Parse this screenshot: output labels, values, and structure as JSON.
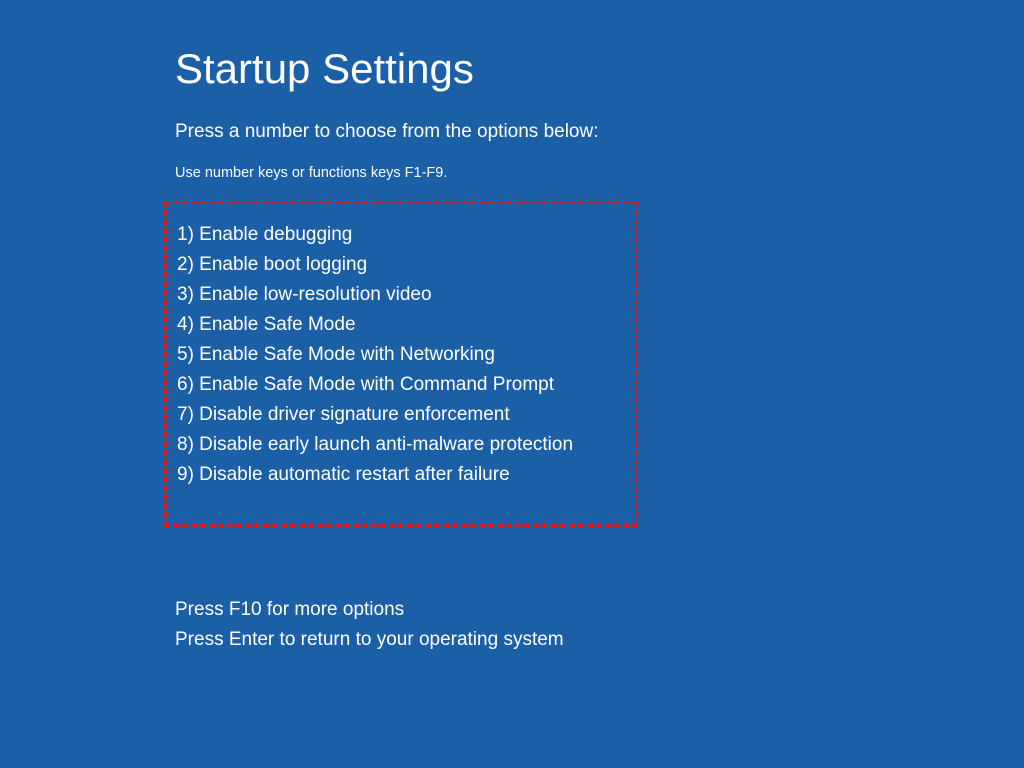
{
  "title": "Startup Settings",
  "subtitle": "Press a number to choose from the options below:",
  "hint": "Use number keys or functions keys F1-F9.",
  "options": {
    "0": "1) Enable debugging",
    "1": "2) Enable boot logging",
    "2": "3) Enable low-resolution video",
    "3": "4) Enable Safe Mode",
    "4": "5) Enable Safe Mode with Networking",
    "5": "6) Enable Safe Mode with Command Prompt",
    "6": "7) Disable driver signature enforcement",
    "7": "8) Disable early launch anti-malware protection",
    "8": "9) Disable automatic restart after failure"
  },
  "bottom": {
    "more": "Press F10 for more options",
    "return": "Press Enter to return to your operating system"
  }
}
